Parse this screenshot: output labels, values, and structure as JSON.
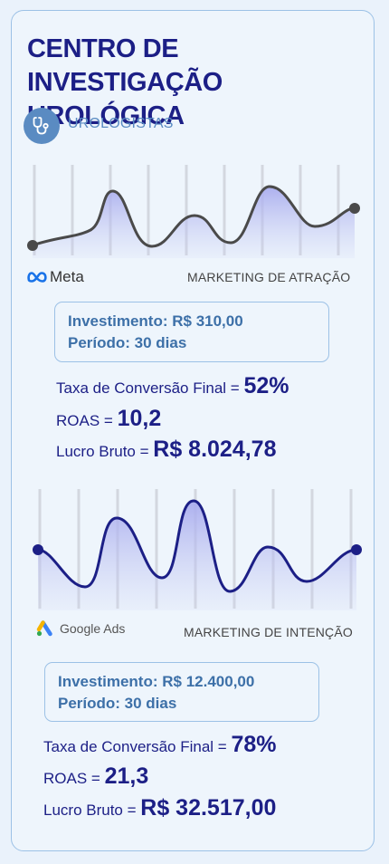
{
  "header": {
    "title_line1": "CENTRO DE INVESTIGAÇÃO",
    "title_line2": "UROLÓGICA",
    "subtitle": "UROLOGISTAS",
    "subtitle_icon": "stethoscope-icon"
  },
  "colors": {
    "title": "#1c1f86",
    "accent": "#5a8bc2",
    "wave1_line": "#4a4a4a",
    "wave2_line": "#1c1f86",
    "fill": "#b9bdf0"
  },
  "sections": [
    {
      "brand": "Meta",
      "brand_icon": "meta-logo-icon",
      "label": "MARKETING DE ATRAÇÃO",
      "investimento": "Investimento: R$ 310,00",
      "periodo": "Período: 30 dias",
      "conversao_label": "Taxa de Conversão Final =",
      "conversao_value": "52%",
      "roas_label": "ROAS =",
      "roas_value": "10,2",
      "lucro_label": "Lucro Bruto =",
      "lucro_value": "R$ 8.024,78"
    },
    {
      "brand": "Google Ads",
      "brand_icon": "google-ads-logo-icon",
      "label": "MARKETING DE INTENÇÃO",
      "investimento": "Investimento: R$ 12.400,00",
      "periodo": "Período: 30 dias",
      "conversao_label": "Taxa de Conversão Final =",
      "conversao_value": "78%",
      "roas_label": "ROAS =",
      "roas_value": "21,3",
      "lucro_label": "Lucro Bruto =",
      "lucro_value": "R$ 32.517,00"
    }
  ]
}
